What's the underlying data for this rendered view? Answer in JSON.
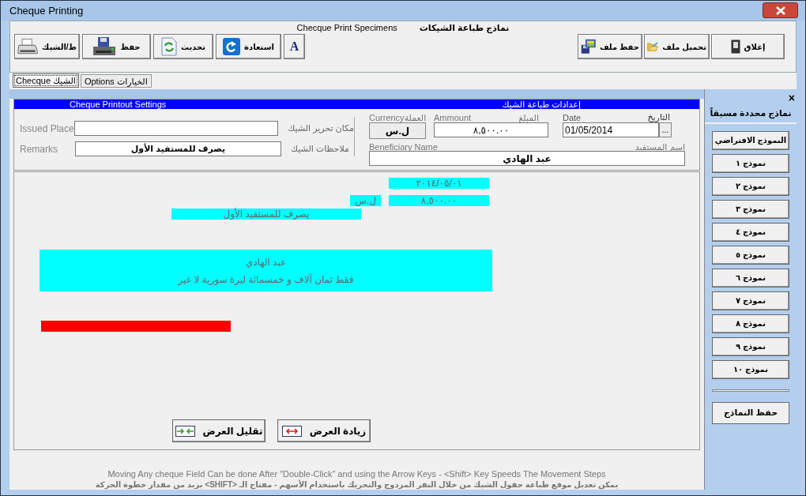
{
  "window": {
    "title": "Cheque Printing"
  },
  "header": {
    "english": "Checque Print Specimens",
    "arabic": "نماذج طباعة الشيكات"
  },
  "toolbar_left": [
    {
      "kind": "font",
      "label": "A"
    },
    {
      "kind": "restore",
      "label": "استعادة"
    },
    {
      "kind": "refresh",
      "label": "تحديث"
    },
    {
      "kind": "save",
      "label": "حفظ"
    },
    {
      "kind": "print",
      "label": "ط/الشيك"
    }
  ],
  "toolbar_right": [
    {
      "kind": "close",
      "label": "إغلاق"
    },
    {
      "kind": "open_file",
      "label": "تحميل ملف"
    },
    {
      "kind": "save_file",
      "label": "حفظ ملف"
    }
  ],
  "tabs": [
    {
      "label": "Options  الخيارات",
      "selected": false
    },
    {
      "label": "Checque الشيك",
      "selected": true
    }
  ],
  "settings": {
    "title_english": "Cheque Printout Settings",
    "title_arabic": "إعدادات طباعة الشيك",
    "issued_place": {
      "label_english": "Issued Place",
      "label_arabic": "مكان تحرير الشيك"
    },
    "remarks": {
      "label_english": "Remarks",
      "label_arabic": "ملاحظات الشيك",
      "value": "يصرف للمستفيد الأول"
    },
    "currency": {
      "label_english": "Currency",
      "label_arabic": "العملة",
      "value": "ل.س"
    },
    "amount": {
      "label_english": "Ammount",
      "label_arabic": "المبلغ",
      "value": "٨,٥٠٠.٠٠"
    },
    "date": {
      "label_english": "Date",
      "label_arabic": "التاريخ",
      "value": "01/05/2014",
      "button": "..."
    },
    "beneficiary": {
      "label_english": "Beneficiary Name",
      "label_arabic": "اسم المستفيد",
      "value": "عبد الهادي"
    }
  },
  "preview": [
    {
      "kind": "field",
      "lines": [
        "٢٠١٤/٠٥/٠١"
      ],
      "color": "#00ffff"
    },
    {
      "kind": "field",
      "lines": [
        "ل.س"
      ],
      "color": "#00ffff"
    },
    {
      "kind": "field",
      "lines": [
        "٨,٥٠٠.٠٠"
      ],
      "color": "#00ffff"
    },
    {
      "kind": "field",
      "lines": [
        "يصرف للمستفيد الأول"
      ],
      "color": "#00ffff"
    },
    {
      "kind": "field",
      "lines": [
        "عبد الهادي",
        "فقط ثمان آلاف و خمسمائة ليرة سورية لا غير"
      ],
      "color": "#00ffff"
    },
    {
      "kind": "bar",
      "color": "#ff0000"
    }
  ],
  "width_buttons": [
    {
      "kind": "increase",
      "label": "زيادة العرض"
    },
    {
      "kind": "decrease",
      "label": "تقليل العرض"
    }
  ],
  "sidebar": {
    "close": "×",
    "title": "نماذج محددة مسبقاً",
    "templates": [
      "النموذج الافتراضي",
      "نموذج ١",
      "نموذج ٢",
      "نموذج ٣",
      "نموذج ٤",
      "نموذج ٥",
      "نموذج ٦",
      "نموذج ٧",
      "نموذج ٨",
      "نموذج ٩",
      "نموذج ١٠"
    ],
    "save": "حفظ النماذج"
  },
  "footer": {
    "english": "Moving Any cheque Field Can be done After \"Double-Click\" and using the Arrow Keys - <Shift> Key Speeds The Movement Steps",
    "arabic": "يمكن تعديل موقع طباعة حقول الشيك من خلال النقر المزدوج والتحريك باستخدام الأسهم - مفتاح الـ <SHIFT> يزيد من مقدار خطوة الحركة"
  }
}
